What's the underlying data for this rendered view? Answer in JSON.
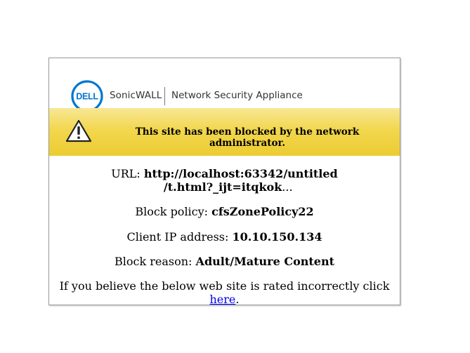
{
  "brand": {
    "logo_text": "DELL",
    "name": "SonicWALL",
    "product": "Network Security Appliance"
  },
  "alert": {
    "icon": "warning-icon",
    "message": "This site has been blocked by the network administrator."
  },
  "details": {
    "url_label": "URL:",
    "url_line1": "http://localhost:63342/untitled",
    "url_line2": "/t.html?_ijt=itqkok",
    "url_ellipsis": "...",
    "policy_label": "Block policy:",
    "policy_value": "cfsZonePolicy22",
    "ip_label": "Client IP address:",
    "ip_value": "10.10.150.134",
    "reason_label": "Block reason:",
    "reason_value": "Adult/Mature Content"
  },
  "note": {
    "text": "If you believe the below web site is rated incorrectly click",
    "link_text": "here",
    "trailing": "."
  },
  "colors": {
    "dell_blue": "#0076ce",
    "banner_yellow": "#f2d74f"
  }
}
